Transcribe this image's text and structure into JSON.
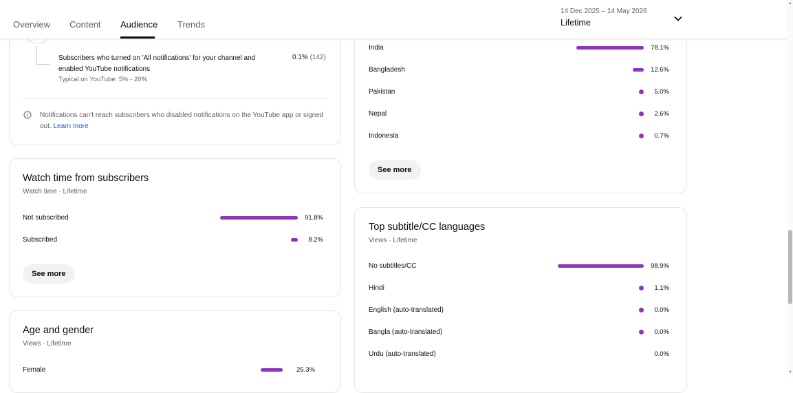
{
  "header": {
    "tabs": [
      {
        "label": "Overview"
      },
      {
        "label": "Content"
      },
      {
        "label": "Audience"
      },
      {
        "label": "Trends"
      }
    ],
    "date_range": "14 Dec 2025 – 14 May 2026",
    "period": "Lifetime"
  },
  "notifications": {
    "row_text": "Subscribers who turned on 'All notifications' for your channel and enabled YouTube notifications",
    "typical": "Typical on YouTube: 5% - 20%",
    "pct": "0.1%",
    "count": "(142)",
    "info_text": "Notifications can't reach subscribers who disabled notifications on the YouTube app or signed out.",
    "learn_more": "Learn more"
  },
  "watch_time": {
    "title": "Watch time from subscribers",
    "subtitle": "Watch time · Lifetime",
    "rows": [
      {
        "label": "Not subscribed",
        "value": "91.8%",
        "share": 0.918
      },
      {
        "label": "Subscribed",
        "value": "8.2%",
        "share": 0.082
      }
    ],
    "see_more": "See more"
  },
  "age_gender": {
    "title": "Age and gender",
    "subtitle": "Views · Lifetime",
    "rows": [
      {
        "label": "Female",
        "value": "25.3%",
        "share": 0.253
      }
    ]
  },
  "geography": {
    "rows": [
      {
        "label": "India",
        "value": "78.1%",
        "share": 0.781
      },
      {
        "label": "Bangladesh",
        "value": "12.6%",
        "share": 0.126
      },
      {
        "label": "Pakistan",
        "value": "5.0%",
        "share": 0.05
      },
      {
        "label": "Nepal",
        "value": "2.6%",
        "share": 0.026
      },
      {
        "label": "Indonesia",
        "value": "0.7%",
        "share": 0.007
      }
    ],
    "see_more": "See more"
  },
  "subtitles": {
    "title": "Top subtitle/CC languages",
    "subtitle": "Views · Lifetime",
    "rows": [
      {
        "label": "No subtitles/CC",
        "value": "98.9%",
        "share": 0.989
      },
      {
        "label": "Hindi",
        "value": "1.1%",
        "share": 0.011
      },
      {
        "label": "English (auto-translated)",
        "value": "0.0%",
        "share": 0.0
      },
      {
        "label": "Bangla (auto-translated)",
        "value": "0.0%",
        "share": 0.0
      },
      {
        "label": "Urdu (auto-translated)",
        "value": "0.0%",
        "share": 0.0
      }
    ]
  },
  "colors": {
    "bar": "#8e35b8"
  }
}
